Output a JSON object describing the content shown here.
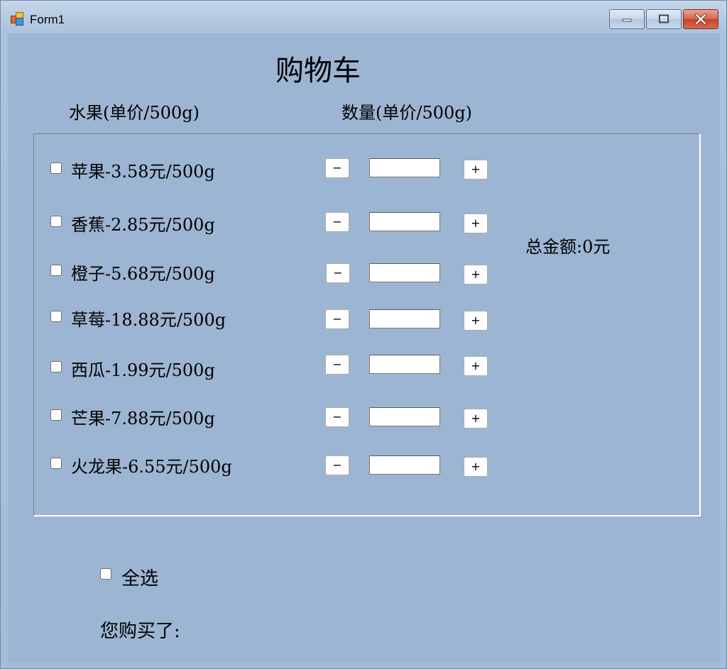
{
  "window": {
    "title": "Form1",
    "controls": {
      "minimize": "minimize-icon",
      "maximize": "maximize-icon",
      "close": "close-icon"
    }
  },
  "heading": "购物车",
  "columns": {
    "fruit": "水果(单价/500g)",
    "quantity": "数量(单价/500g)"
  },
  "items": [
    {
      "label": "苹果-3.58元/500g",
      "checked": false,
      "quantity": ""
    },
    {
      "label": "香蕉-2.85元/500g",
      "checked": false,
      "quantity": ""
    },
    {
      "label": "橙子-5.68元/500g",
      "checked": false,
      "quantity": ""
    },
    {
      "label": "草莓-18.88元/500g",
      "checked": false,
      "quantity": ""
    },
    {
      "label": "西瓜-1.99元/500g",
      "checked": false,
      "quantity": ""
    },
    {
      "label": "芒果-7.88元/500g",
      "checked": false,
      "quantity": ""
    },
    {
      "label": "火龙果-6.55元/500g",
      "checked": false,
      "quantity": ""
    }
  ],
  "buttons": {
    "minus": "−",
    "plus": "+"
  },
  "total": "总金额:0元",
  "select_all": {
    "label": "全选",
    "checked": false
  },
  "purchased": "您购买了:",
  "colors": {
    "client_background": "#9cb5d2",
    "close_button": "#c8432a"
  }
}
